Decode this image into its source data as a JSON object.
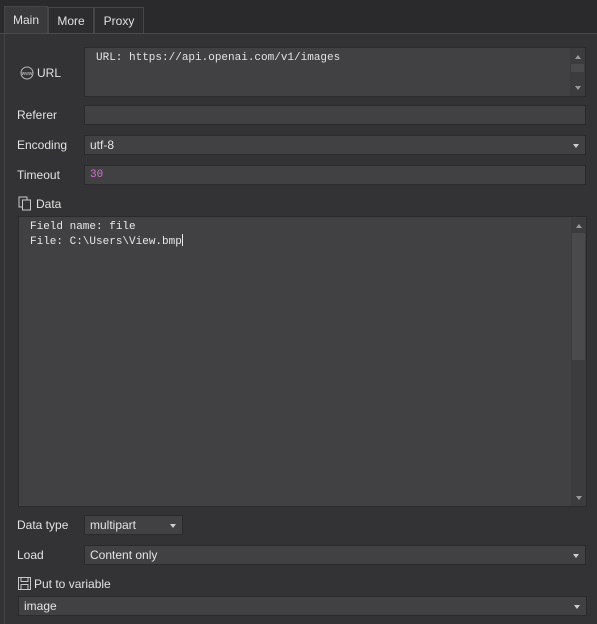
{
  "tabs": [
    {
      "label": "Main",
      "active": true
    },
    {
      "label": "More",
      "active": false
    },
    {
      "label": "Proxy",
      "active": false
    }
  ],
  "url": {
    "label": "URL",
    "icon": "www-icon",
    "value": "URL: https://api.openai.com/v1/images"
  },
  "referer": {
    "label": "Referer",
    "value": ""
  },
  "encoding": {
    "label": "Encoding",
    "value": "utf-8"
  },
  "timeout": {
    "label": "Timeout",
    "value": "30",
    "value_color": "#d070d0"
  },
  "data": {
    "label": "Data",
    "icon": "copy-icon",
    "lines": [
      "Field name: file",
      "File: C:\\Users\\View.bmp"
    ]
  },
  "data_type": {
    "label": "Data type",
    "value": "multipart"
  },
  "load": {
    "label": "Load",
    "value": "Content only"
  },
  "put_to_variable": {
    "label": "Put to variable",
    "icon": "save-icon",
    "value": "image"
  }
}
